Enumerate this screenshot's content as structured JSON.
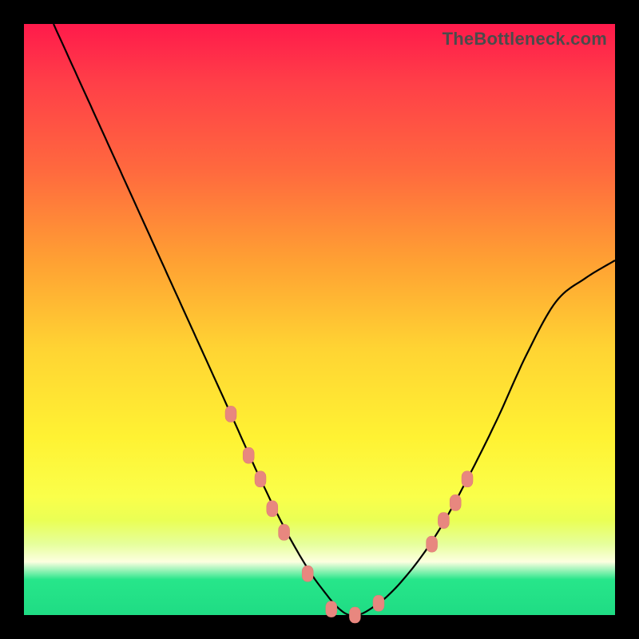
{
  "watermark": "TheBottleneck.com",
  "chart_data": {
    "type": "line",
    "title": "",
    "xlabel": "",
    "ylabel": "",
    "xlim": [
      0,
      100
    ],
    "ylim": [
      0,
      100
    ],
    "grid": false,
    "series": [
      {
        "name": "bottleneck-curve",
        "x": [
          5,
          10,
          15,
          20,
          25,
          30,
          35,
          40,
          45,
          50,
          55,
          60,
          65,
          70,
          75,
          80,
          85,
          90,
          95,
          100
        ],
        "values": [
          100,
          89,
          78,
          67,
          56,
          45,
          34,
          23,
          13,
          5,
          0,
          2,
          7,
          14,
          23,
          33,
          44,
          53,
          57,
          60
        ]
      }
    ],
    "markers": {
      "name": "highlighted-points",
      "x": [
        35,
        38,
        40,
        42,
        44,
        48,
        52,
        56,
        60,
        69,
        71,
        73,
        75
      ],
      "values": [
        34,
        27,
        23,
        18,
        14,
        7,
        1,
        0,
        2,
        12,
        16,
        19,
        23
      ]
    },
    "colors": {
      "gradient_top": "#ff1a4b",
      "gradient_mid": "#fff233",
      "gradient_bottom": "#1fdc84",
      "curve": "#000000",
      "marker": "#e8877f"
    }
  }
}
